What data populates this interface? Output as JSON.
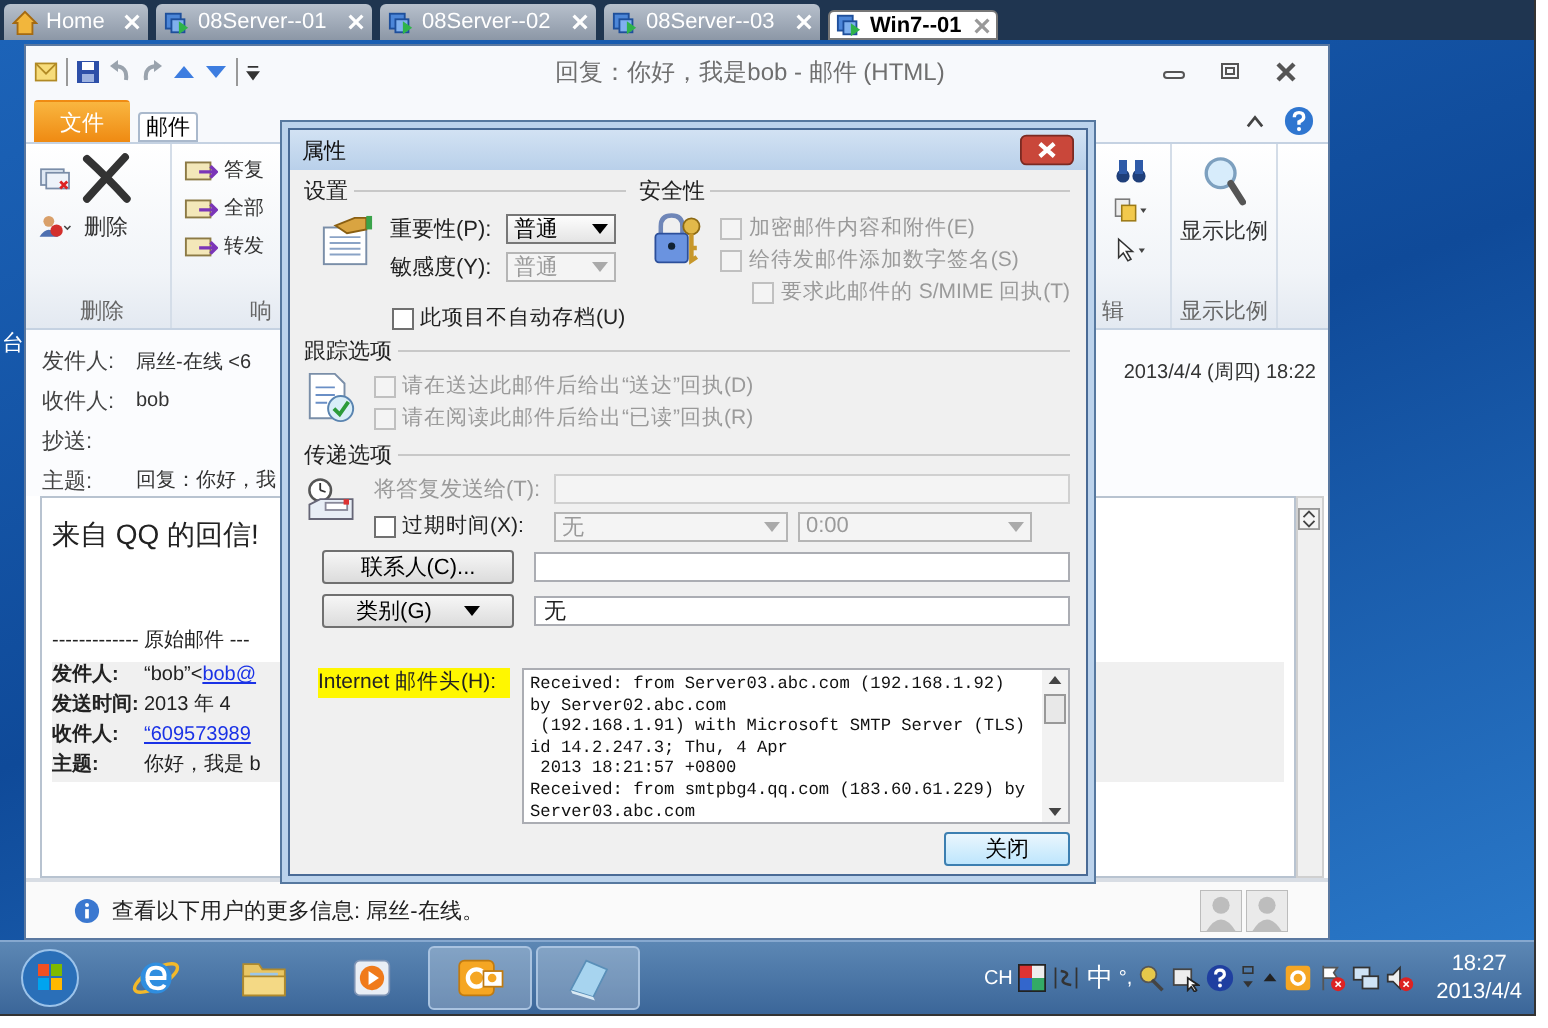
{
  "vm_tabs": [
    {
      "label": "Home",
      "kind": "home",
      "selected": false
    },
    {
      "label": "08Server--01",
      "kind": "vm",
      "selected": false
    },
    {
      "label": "08Server--02",
      "kind": "vm",
      "selected": false
    },
    {
      "label": "08Server--03",
      "kind": "vm",
      "selected": false
    },
    {
      "label": "Win7--01",
      "kind": "vm",
      "selected": true
    }
  ],
  "desktop_label": "台",
  "mail_window": {
    "title": "回复：你好，我是bob - 邮件 (HTML)",
    "ribbon": {
      "tabs": [
        {
          "label": "文件",
          "kind": "file",
          "selected": false
        },
        {
          "label": "邮件",
          "kind": "tab",
          "selected": true
        }
      ],
      "delete_group": {
        "button": "删除",
        "label": "删除"
      },
      "respond_group": {
        "buttons": [
          "答复",
          "全部",
          "转发"
        ],
        "label": "响"
      },
      "edit_group": {
        "label": "辑"
      },
      "zoom_group": {
        "button": "显示比例",
        "label": "显示比例"
      }
    },
    "header": {
      "fields": [
        {
          "label": "发件人:",
          "value": "屌丝-在线 <6"
        },
        {
          "label": "收件人:",
          "value": "bob"
        },
        {
          "label": "抄送:"
        },
        {
          "label": "主题:",
          "value": "回复：你好，我"
        }
      ],
      "date": "2013/4/4 (周四) 18:22"
    },
    "body": {
      "greeting": "来自 QQ 的回信!",
      "divider": "------------- 原始邮件 ---",
      "fields": [
        {
          "label": "发件人:",
          "value": "“bob”<",
          "link": "bob@"
        },
        {
          "label": "发送时间:",
          "value": "2013 年 4"
        },
        {
          "label": "收件人:",
          "link": "“609573989"
        },
        {
          "label": "主题:",
          "value": "你好，我是 b"
        }
      ]
    },
    "info_bar": "查看以下用户的更多信息: 屌丝-在线。"
  },
  "properties_dialog": {
    "title": "属性",
    "settings": {
      "heading": "设置",
      "importance": {
        "label": "重要性(P):",
        "value": "普通",
        "disabled": false
      },
      "sensitivity": {
        "label": "敏感度(Y):",
        "value": "普通",
        "disabled": true
      },
      "no_autoarchive": {
        "label": "此项目不自动存档(U)",
        "checked": false,
        "disabled": false
      }
    },
    "security": {
      "heading": "安全性",
      "options": [
        {
          "label": "加密邮件内容和附件(E)",
          "checked": false,
          "disabled": true,
          "indented": false
        },
        {
          "label": "给待发邮件添加数字签名(S)",
          "checked": false,
          "disabled": true,
          "indented": false
        },
        {
          "label": "要求此邮件的 S/MIME 回执(T)",
          "checked": false,
          "disabled": true,
          "indented": true
        }
      ]
    },
    "tracking": {
      "heading": "跟踪选项",
      "options": [
        {
          "label": "请在送达此邮件后给出“送达”回执(D)",
          "checked": false,
          "disabled": true
        },
        {
          "label": "请在阅读此邮件后给出“已读”回执(R)",
          "checked": false,
          "disabled": true
        }
      ]
    },
    "delivery": {
      "heading": "传递选项",
      "reply_to": {
        "label": "将答复发送给(T):",
        "disabled": true
      },
      "expires": {
        "label": "过期时间(X):",
        "checked": false,
        "disabled": false,
        "date": {
          "value": "无",
          "disabled": true
        },
        "time": {
          "value": "0:00",
          "disabled": true
        }
      }
    },
    "contacts_button": "联系人(C)...",
    "categories": {
      "button": "类别(G)",
      "value": "无"
    },
    "internet_headers": {
      "label": "Internet 邮件头(H):",
      "lines": [
        "Received: from Server03.abc.com (192.168.1.92)",
        "by Server02.abc.com",
        " (192.168.1.91) with Microsoft SMTP Server (TLS)",
        "id 14.2.247.3; Thu, 4 Apr",
        " 2013 18:21:57 +0800",
        "Received: from smtpbg4.qq.com (183.60.61.229) by",
        "Server03.abc.com"
      ]
    },
    "close_button": "关闭"
  },
  "taskbar": {
    "apps": [
      {
        "kind": "ie",
        "running": false
      },
      {
        "kind": "folder",
        "running": false
      },
      {
        "kind": "media",
        "running": false
      },
      {
        "kind": "outlook",
        "running": true
      },
      {
        "kind": "notepad",
        "running": true
      }
    ],
    "tray": {
      "language": "CH",
      "ime_mode": "中",
      "punctuation": "°,",
      "time": "18:27",
      "date": "2013/4/4"
    }
  }
}
